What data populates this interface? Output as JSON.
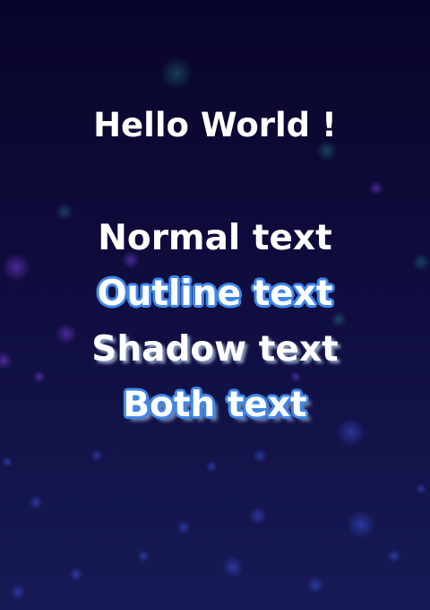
{
  "title": "Hello World !",
  "samples": {
    "normal": "Normal text",
    "outline": "Outline text",
    "shadow": "Shadow text",
    "both": "Both text"
  },
  "colors": {
    "background_top": "#08052a",
    "background_bottom": "#171a55",
    "text": "#ffffff",
    "outline": "#3f87e8",
    "shadow": "#c8e6ff"
  }
}
